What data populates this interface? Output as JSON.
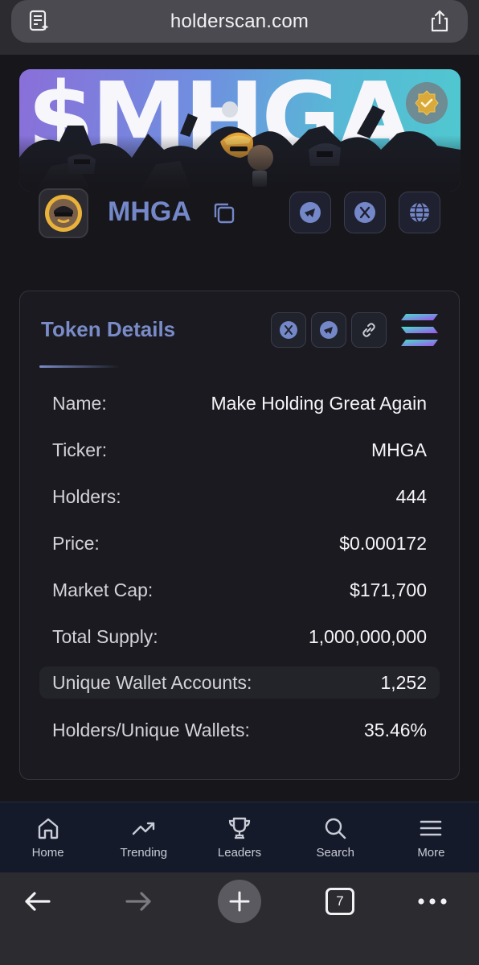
{
  "browser": {
    "url": "holderscan.com",
    "open_tabs_count": "7"
  },
  "banner": {
    "text": "$MHGA"
  },
  "token": {
    "symbol_display": "MHGA"
  },
  "token_details": {
    "title": "Token Details",
    "rows": [
      {
        "label": "Name:",
        "value": "Make Holding Great Again"
      },
      {
        "label": "Ticker:",
        "value": "MHGA"
      },
      {
        "label": "Holders:",
        "value": "444"
      },
      {
        "label": "Price:",
        "value": "$0.000172"
      },
      {
        "label": "Market Cap:",
        "value": "$171,700"
      },
      {
        "label": "Total Supply:",
        "value": "1,000,000,000"
      },
      {
        "label": "Unique Wallet Accounts:",
        "value": "1,252"
      },
      {
        "label": "Holders/Unique Wallets:",
        "value": "35.46%"
      }
    ]
  },
  "bottom_nav": {
    "items": [
      {
        "label": "Home",
        "icon": "home-icon"
      },
      {
        "label": "Trending",
        "icon": "trending-icon"
      },
      {
        "label": "Leaders",
        "icon": "trophy-icon"
      },
      {
        "label": "Search",
        "icon": "search-icon"
      },
      {
        "label": "More",
        "icon": "menu-icon"
      }
    ]
  },
  "colors": {
    "accent": "#7487c8",
    "background": "#16161b",
    "nav_bg": "#141a2a"
  }
}
